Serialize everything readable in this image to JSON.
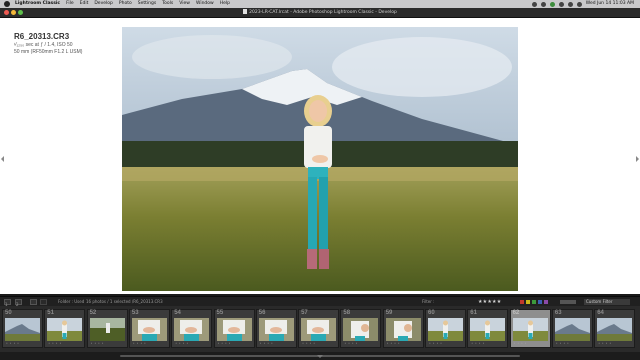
{
  "menubar": {
    "items": [
      "Lightroom Classic",
      "File",
      "Edit",
      "Develop",
      "Photo",
      "Settings",
      "Tools",
      "View",
      "Window",
      "Help"
    ],
    "clock": "Wed Jun 14  11:03 AM"
  },
  "window": {
    "title": "2023-LR-CAT.lrcat - Adobe Photoshop Lightroom Classic - Develop"
  },
  "loupe_info": {
    "filename": "R6_20313.CR3",
    "exposure": "¹⁄₁₂₅₀ sec at ƒ / 1.4, ISO 50",
    "lens": "50 mm (RF50mm F1.2 L USM)"
  },
  "filmstrip_toolbar": {
    "page1": "1",
    "page2": "2",
    "source": "Folder : Used",
    "count": "16 photos / 1 selected /R6_20313.CR3",
    "filter_label": "Filter :",
    "stars": "★★★★★",
    "custom_filter": "Custom Filter",
    "colors": {
      "red": "#c0392b",
      "yellow": "#c9b81a",
      "green": "#3c9a3c",
      "blue": "#3b5fb4",
      "purple": "#8a4aa8"
    }
  },
  "filmstrip": {
    "cells": [
      {
        "num": "50",
        "scene": "mountain"
      },
      {
        "num": "51",
        "scene": "girl"
      },
      {
        "num": "52",
        "scene": "meadow"
      },
      {
        "num": "53",
        "scene": "hands"
      },
      {
        "num": "54",
        "scene": "hands"
      },
      {
        "num": "55",
        "scene": "hands"
      },
      {
        "num": "56",
        "scene": "hands"
      },
      {
        "num": "57",
        "scene": "hands"
      },
      {
        "num": "58",
        "scene": "closeup"
      },
      {
        "num": "59",
        "scene": "closeup"
      },
      {
        "num": "60",
        "scene": "girl"
      },
      {
        "num": "61",
        "scene": "girl"
      },
      {
        "num": "62",
        "scene": "girl-selected"
      },
      {
        "num": "63",
        "scene": "mountain"
      },
      {
        "num": "64",
        "scene": "mountain"
      }
    ],
    "rating_dots": "• • • •"
  }
}
